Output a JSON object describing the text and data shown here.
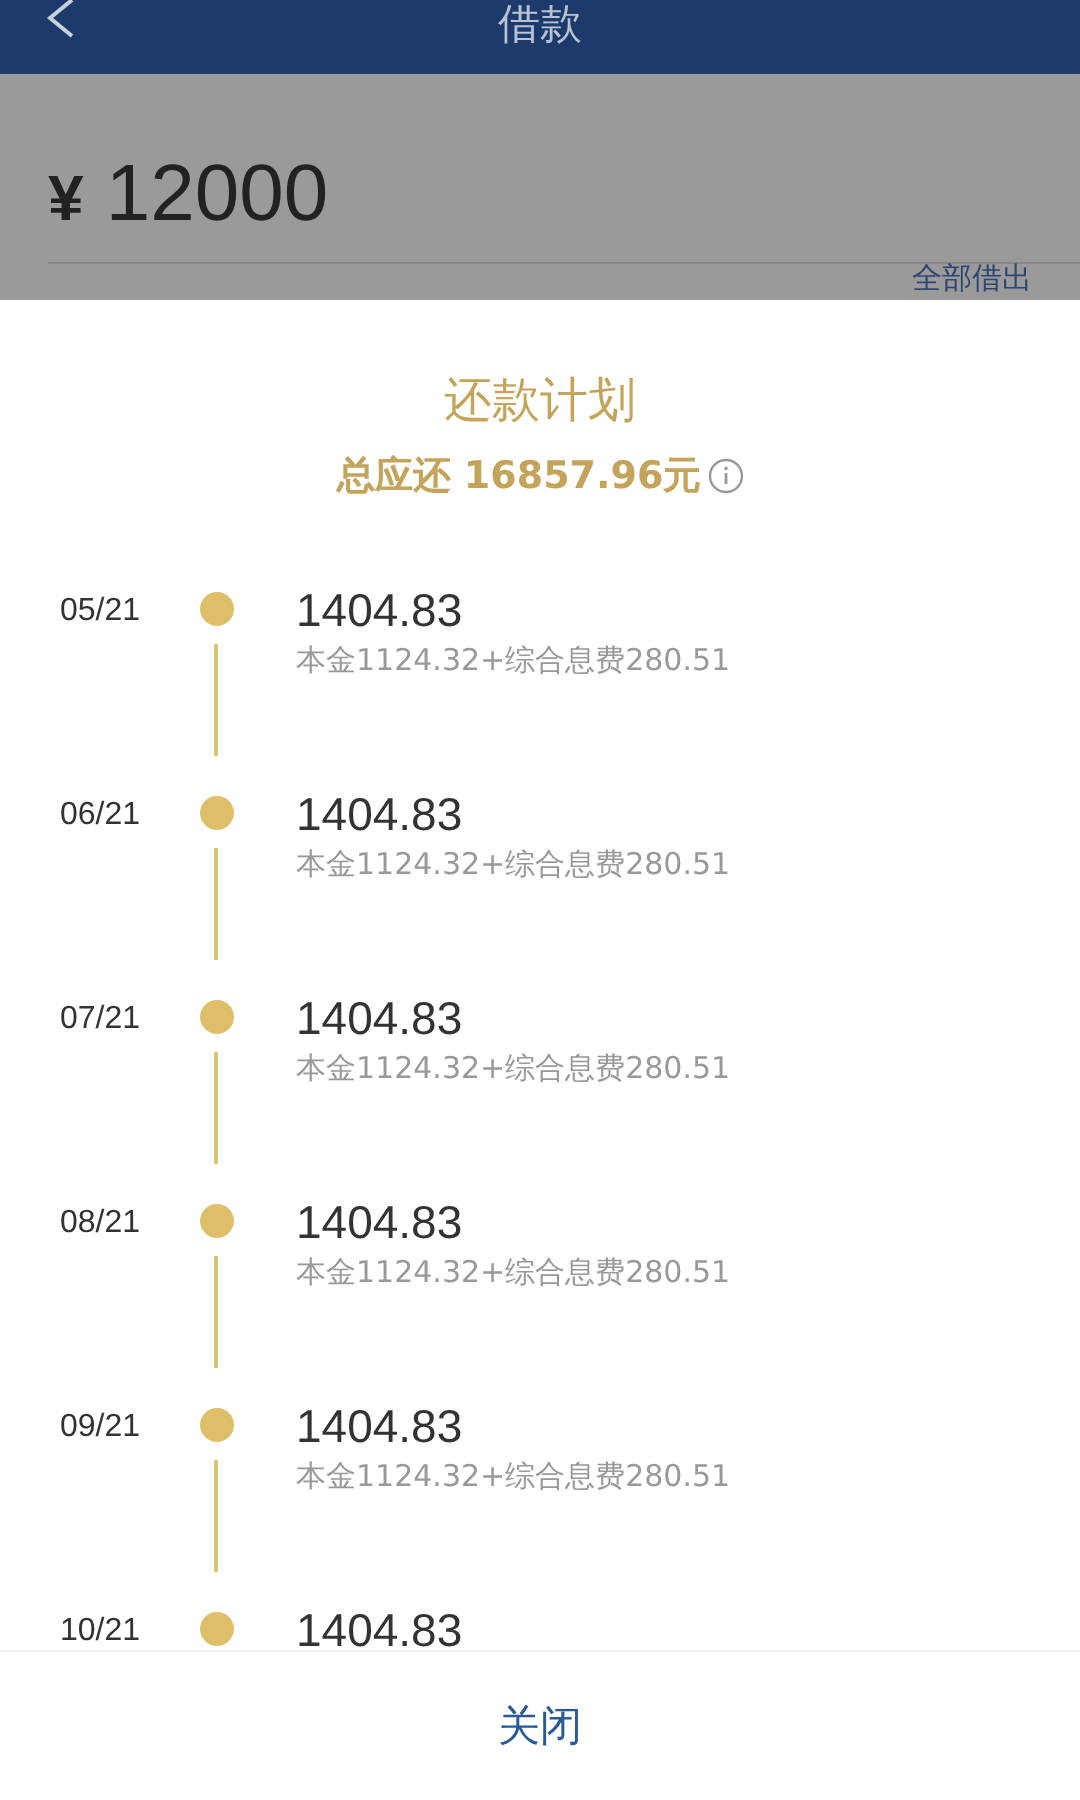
{
  "header": {
    "title": "借款"
  },
  "loan": {
    "currency": "¥",
    "amount": "12000",
    "borrow_all": "全部借出"
  },
  "plan": {
    "title": "还款计划",
    "total_label": "总应还",
    "total_value": "16857.96元",
    "items": [
      {
        "date": "05/21",
        "amount": "1404.83",
        "detail": "本金1124.32+综合息费280.51"
      },
      {
        "date": "06/21",
        "amount": "1404.83",
        "detail": "本金1124.32+综合息费280.51"
      },
      {
        "date": "07/21",
        "amount": "1404.83",
        "detail": "本金1124.32+综合息费280.51"
      },
      {
        "date": "08/21",
        "amount": "1404.83",
        "detail": "本金1124.32+综合息费280.51"
      },
      {
        "date": "09/21",
        "amount": "1404.83",
        "detail": "本金1124.32+综合息费280.51"
      },
      {
        "date": "10/21",
        "amount": "1404.83"
      }
    ],
    "close": "关闭"
  }
}
